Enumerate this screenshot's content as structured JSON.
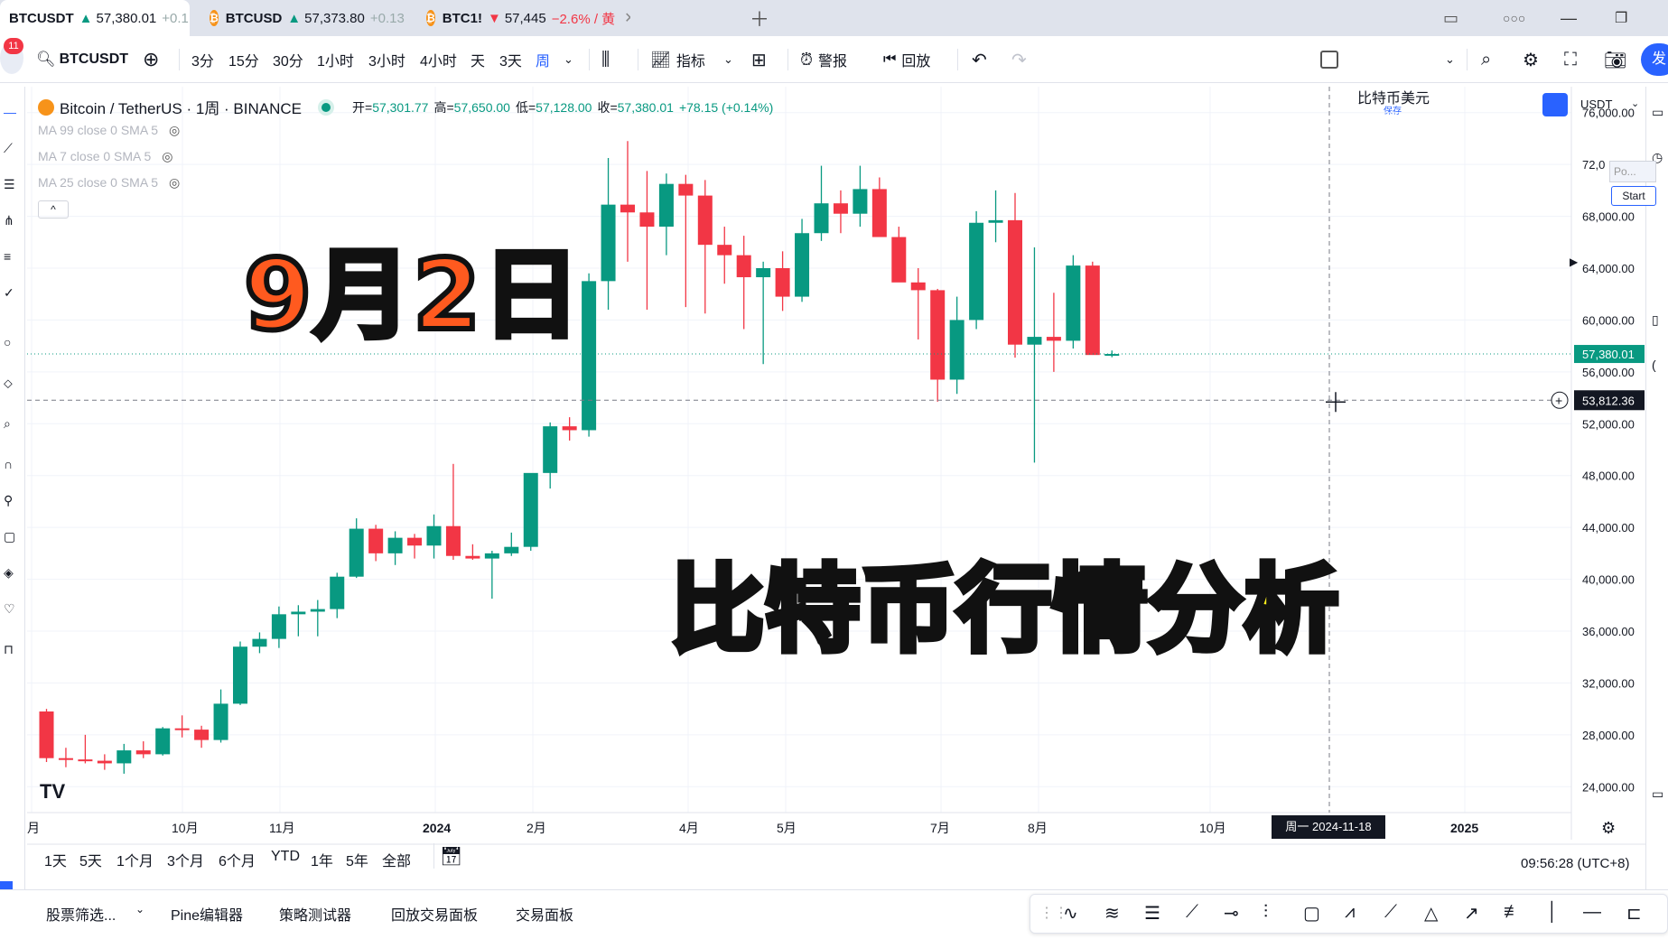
{
  "tabs": [
    {
      "symbol": "BTCUSDT",
      "arrow": "▲",
      "price": "57,380.01",
      "change": "+0.1",
      "active": true
    },
    {
      "symbol": "BTCUSD",
      "arrow": "▲",
      "price": "57,373.80",
      "change": "+0.13",
      "active": false
    },
    {
      "symbol": "BTC1!",
      "arrow": "▼",
      "price": "57,445",
      "change": "−2.6% / 黄",
      "active": false
    }
  ],
  "toolbar": {
    "notif_count": "11",
    "symbol": "BTCUSDT",
    "intervals": [
      "3分",
      "15分",
      "30分",
      "1小时",
      "3小时",
      "4小时",
      "天",
      "3天",
      "周"
    ],
    "active_interval": "周",
    "indicators_label": "指标",
    "alert_label": "警报",
    "replay_label": "回放",
    "layout_name": "比特币美元",
    "layout_sub": "保存",
    "publish_label": "发"
  },
  "legend": {
    "title": "Bitcoin / TetherUS · 1周 · BINANCE",
    "open_label": "开=",
    "open": "57,301.77",
    "high_label": "高=",
    "high": "57,650.00",
    "low_label": "低=",
    "low": "57,128.00",
    "close_label": "收=",
    "close": "57,380.01",
    "change": "+78.15 (+0.14%)",
    "ma": [
      "MA 99 close 0 SMA 5",
      "MA 7 close 0 SMA 5",
      "MA 25 close 0 SMA 5"
    ]
  },
  "overlay": {
    "date_text": "9月2日",
    "title_text": "比特币行情分析"
  },
  "price_axis": {
    "currency": "USDT",
    "labels": [
      "76,000.00",
      "72,0",
      "68,000.00",
      "64,000.00",
      "60,000.00",
      "56,000.00",
      "52,000.00",
      "48,000.00",
      "44,000.00",
      "40,000.00",
      "36,000.00",
      "32,000.00",
      "28,000.00",
      "24,000.00"
    ],
    "last_price": "57,380.01",
    "crosshair_price": "53,812.36",
    "popup_text": "Po...",
    "popup_button": "Start"
  },
  "time_axis": {
    "labels": [
      "月",
      "10月",
      "11月",
      "2024",
      "2月",
      "4月",
      "5月",
      "7月",
      "8月",
      "10月",
      "2025"
    ],
    "crosshair_date": "周一  2024-11-18"
  },
  "ranges": [
    "1天",
    "5天",
    "1个月",
    "3个月",
    "6个月",
    "YTD",
    "1年",
    "5年",
    "全部"
  ],
  "clock": "09:56:28 (UTC+8)",
  "bottom_panel": [
    "股票筛选...",
    "Pine编辑器",
    "策略测试器",
    "回放交易面板",
    "交易面板"
  ],
  "chart_data": {
    "type": "candlestick",
    "title": "Bitcoin / TetherUS · 1周 · BINANCE",
    "ylim": [
      22000,
      78000
    ],
    "colors": {
      "up": "#089981",
      "down": "#f23645"
    },
    "candles": [
      [
        29800,
        30000,
        25900,
        26200
      ],
      [
        26200,
        27000,
        25500,
        26100
      ],
      [
        26100,
        28000,
        25800,
        26000
      ],
      [
        26000,
        26500,
        25300,
        25800
      ],
      [
        25800,
        27300,
        25000,
        26800
      ],
      [
        26800,
        27500,
        26200,
        26500
      ],
      [
        26500,
        28600,
        26400,
        28500
      ],
      [
        28500,
        29500,
        27800,
        28400
      ],
      [
        28400,
        28700,
        27000,
        27600
      ],
      [
        27600,
        31500,
        27400,
        30400
      ],
      [
        30400,
        35200,
        30300,
        34800
      ],
      [
        34800,
        35900,
        34300,
        35400
      ],
      [
        35400,
        37900,
        34700,
        37300
      ],
      [
        37300,
        38000,
        35600,
        37500
      ],
      [
        37500,
        38400,
        35600,
        37700
      ],
      [
        37700,
        40500,
        37000,
        40200
      ],
      [
        40200,
        44700,
        40100,
        43900
      ],
      [
        43900,
        44200,
        41400,
        42000
      ],
      [
        42000,
        43700,
        41100,
        43200
      ],
      [
        43200,
        43500,
        41600,
        42600
      ],
      [
        42600,
        45000,
        41600,
        44100
      ],
      [
        44100,
        48900,
        41500,
        41800
      ],
      [
        41800,
        42700,
        41500,
        41600
      ],
      [
        41600,
        42200,
        38500,
        42000
      ],
      [
        42000,
        43600,
        41800,
        42500
      ],
      [
        42500,
        48000,
        42200,
        48200
      ],
      [
        48200,
        52100,
        47000,
        51800
      ],
      [
        51800,
        52500,
        50700,
        51500
      ],
      [
        51500,
        63600,
        51000,
        63000
      ],
      [
        63000,
        72500,
        60800,
        68900
      ],
      [
        68900,
        73800,
        64500,
        68300
      ],
      [
        68300,
        71500,
        60800,
        67200
      ],
      [
        67200,
        71300,
        65000,
        70500
      ],
      [
        70500,
        71200,
        61000,
        69600
      ],
      [
        69600,
        70800,
        60500,
        65800
      ],
      [
        65800,
        67200,
        62800,
        65000
      ],
      [
        65000,
        66500,
        59300,
        63300
      ],
      [
        63300,
        64500,
        56600,
        64000
      ],
      [
        64000,
        65300,
        60700,
        61800
      ],
      [
        61800,
        67800,
        61400,
        66700
      ],
      [
        66700,
        71900,
        66100,
        69000
      ],
      [
        69000,
        70000,
        66700,
        68200
      ],
      [
        68200,
        71900,
        67200,
        70100
      ],
      [
        70100,
        71000,
        66600,
        66400
      ],
      [
        66400,
        67200,
        65000,
        62900
      ],
      [
        62900,
        64000,
        58500,
        62300
      ],
      [
        62300,
        62400,
        53700,
        55400
      ],
      [
        55400,
        61800,
        54300,
        60000
      ],
      [
        60000,
        68400,
        59300,
        67500
      ],
      [
        67500,
        70000,
        66000,
        67700
      ],
      [
        67700,
        69800,
        57100,
        58100
      ],
      [
        58100,
        65600,
        49000,
        58700
      ],
      [
        58700,
        62100,
        56000,
        58400
      ],
      [
        58400,
        65000,
        57800,
        64200
      ],
      [
        64200,
        64500,
        57500,
        57300
      ],
      [
        57301.77,
        57650,
        57128,
        57380.01
      ]
    ]
  }
}
